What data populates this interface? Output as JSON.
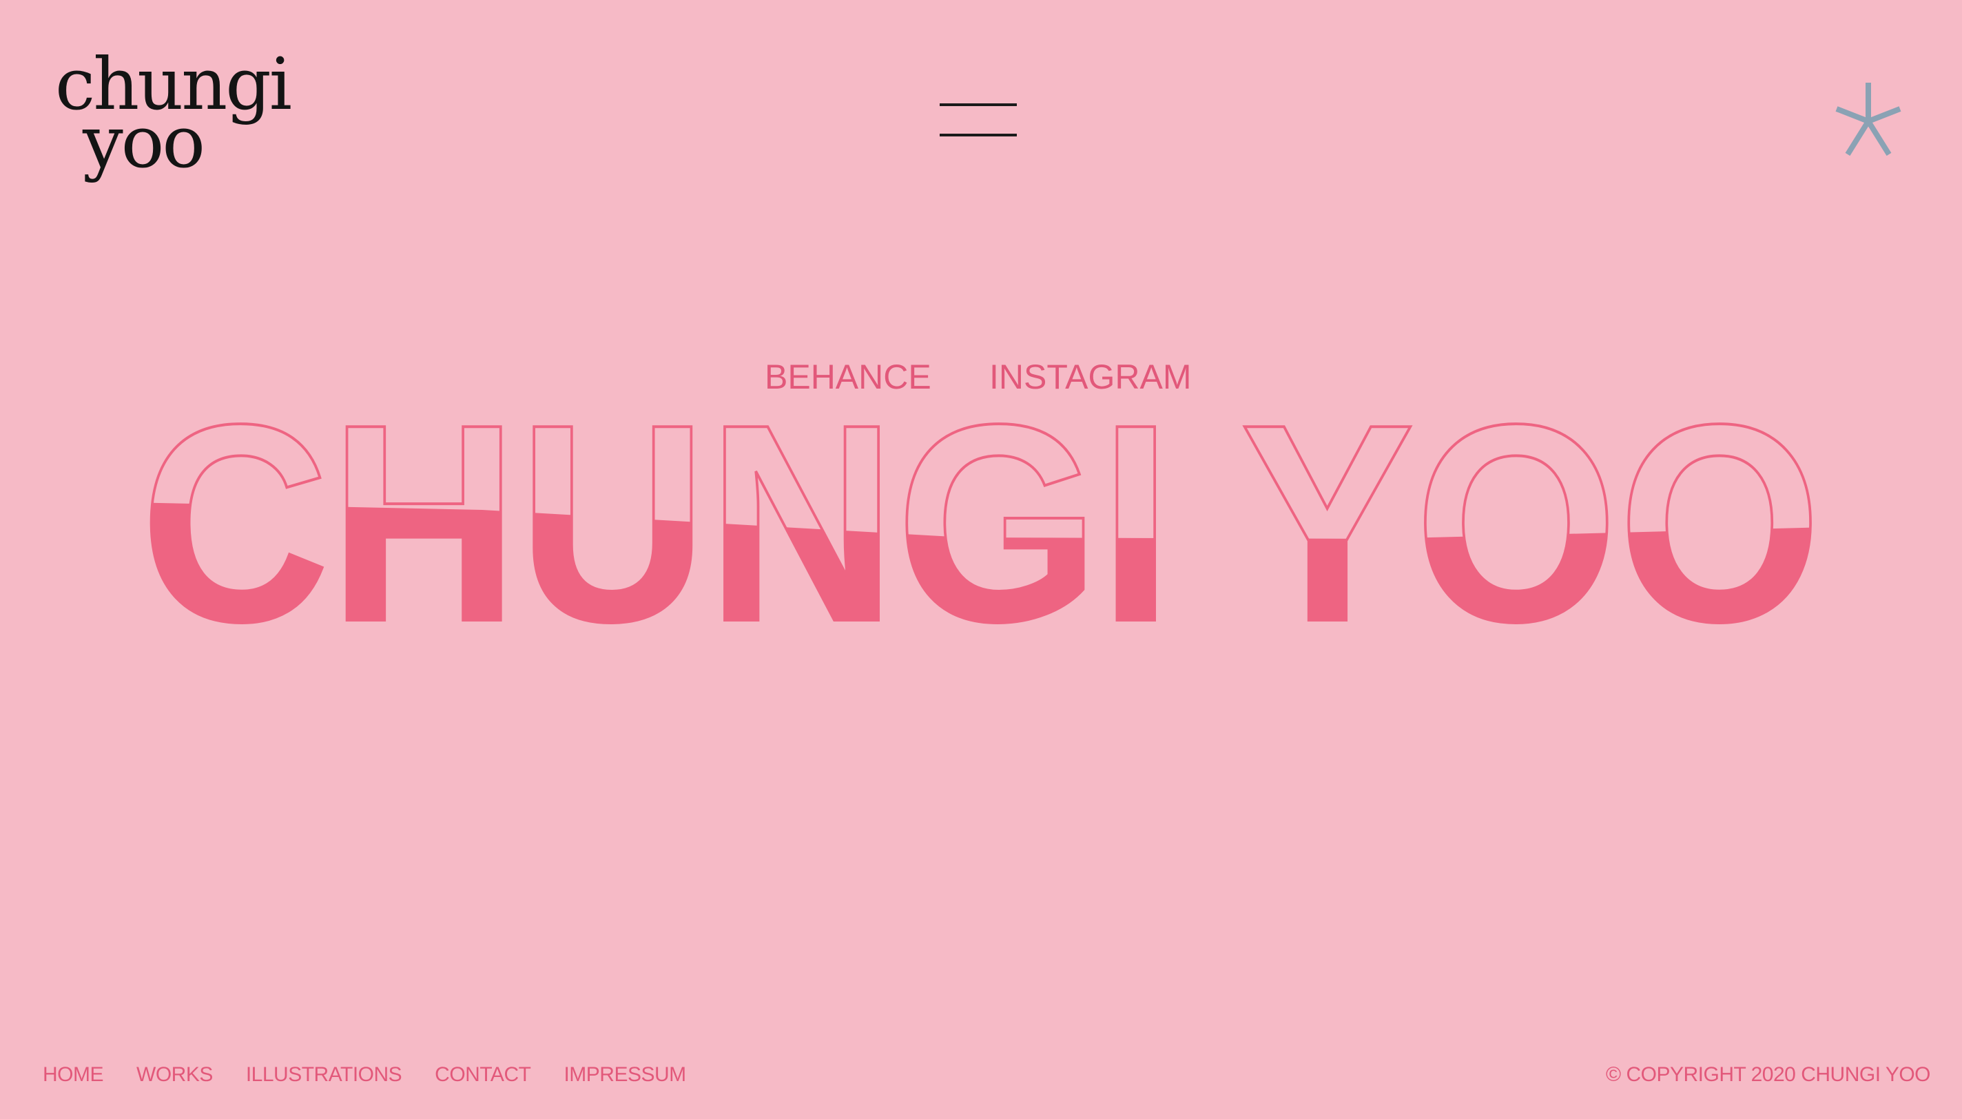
{
  "brand": {
    "logo_line1": "chungi",
    "logo_line2": "yoo"
  },
  "header": {
    "menu_icon": "hamburger-icon",
    "decor_icon": "asterisk-icon"
  },
  "social": {
    "behance": "BEHANCE",
    "instagram": "INSTAGRAM"
  },
  "hero": {
    "title": "CHUNGI YOO"
  },
  "footer": {
    "nav": [
      "HOME",
      "WORKS",
      "ILLUSTRATIONS",
      "CONTACT",
      "IMPRESSUM"
    ],
    "copyright": "© COPYRIGHT 2020 CHUNGI YOO"
  },
  "colors": {
    "background": "#f6bac6",
    "accent": "#e2587a",
    "fill": "#ee6482",
    "asterisk": "#8aa2b4",
    "ink": "#141414"
  }
}
